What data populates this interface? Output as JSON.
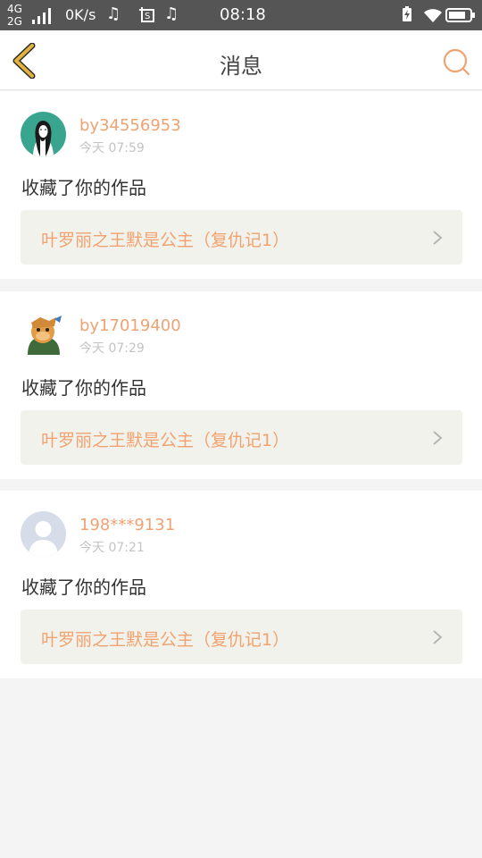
{
  "status_bar": {
    "network_top": "4G",
    "network_bottom": "2G",
    "speed": "0K/s",
    "time": "08:18"
  },
  "header": {
    "title": "消息"
  },
  "messages": [
    {
      "username": "by34556953",
      "time": "今天 07:59",
      "action": "收藏了你的作品",
      "work_title": "叶罗丽之王默是公主（复仇记1）"
    },
    {
      "username": "by17019400",
      "time": "今天 07:29",
      "action": "收藏了你的作品",
      "work_title": "叶罗丽之王默是公主（复仇记1）"
    },
    {
      "username": "198***9131",
      "time": "今天 07:21",
      "action": "收藏了你的作品",
      "work_title": "叶罗丽之王默是公主（复仇记1）"
    }
  ],
  "colors": {
    "accent": "#f0a272",
    "back_icon": "#e2b23e",
    "status_bar": "#555555"
  }
}
